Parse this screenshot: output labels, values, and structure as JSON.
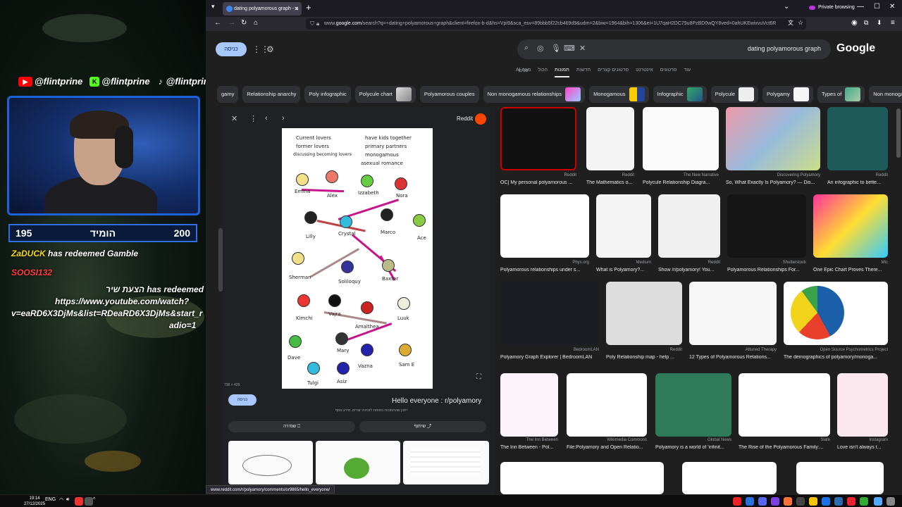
{
  "stream": {
    "socials": [
      "@flintprine",
      "@flintprine",
      "@flintprine"
    ],
    "bet": {
      "left_value": "195",
      "label": "הומיד",
      "right_value": "200"
    },
    "chat": [
      {
        "user": "ZaDUCK",
        "text": "has redeemed Gamble"
      },
      {
        "user": "SOOSI132",
        "text": ""
      },
      {
        "user": "הצעת שיר",
        "text": "has redeemed"
      },
      {
        "text_lines": [
          "https://www.youtube.com/watch?",
          "v=eaRD6X3DjMs&list=RDeaRD6X3DjMs&start_r",
          "adio=1"
        ]
      }
    ]
  },
  "browser": {
    "tab_title": "dating polyamorous graph - ב",
    "private_label": "Private browsing",
    "url_prefix": "www.",
    "url_domain": "google.com",
    "url_rest": "/search?q=+dating+polyamorous+graph&client=firefox-b-d&hs=Vpi9&sca_esv=89bbb5f22cb469d9&udm=2&biw=1964&bih=1306&ei=1U7qaH2DC79u8PzBD0wQY8ved=0ahUKEwixvuVct6R"
  },
  "google": {
    "signin_label": "כניסה",
    "query": "dating polyamorous graph",
    "logo": "Google",
    "tabs": [
      "מצב AI",
      "הכול",
      "תמונות",
      "חדשות",
      "סרטונים קצרים",
      "אינטרנט",
      "סרטונים",
      "עוד"
    ],
    "tools_label": "כלים",
    "chips": [
      "gamy",
      "Relationship anarchy",
      "Poly infographic",
      "Polycule chart",
      "Polyamorous couples",
      "Non monogamous relationships",
      "Monogamous",
      "Infographic",
      "Polycule",
      "Polygamy",
      "Types of",
      "Non monogamy"
    ]
  },
  "preview": {
    "source": "Reddit",
    "size": "738 × 429",
    "visit_label": "כניסה",
    "title": "Hello everyone : r/polyamory",
    "subtitle": "ייתכן שהתמונות כפופות לזכויות יוצרים. מידע נוסף",
    "share_label": "שיתוף",
    "save_label": "שמירה",
    "legend": [
      "Current lovers",
      "have kids together",
      "former lovers",
      "primary partners",
      "discussing becoming lovers",
      "monogamous",
      "asexual romance"
    ],
    "names": [
      "Emma",
      "Alex",
      "Izzabeth",
      "Nora",
      "Lilly",
      "Crystal",
      "Marco",
      "Ace",
      "Sherman",
      "Soliloquy",
      "Baxter",
      "Kimchi",
      "Vajra",
      "Amalthea",
      "Luuk",
      "Dave",
      "Mary",
      "Vazna",
      "Sam E",
      "Tulgi",
      "Asiz"
    ]
  },
  "results": [
    {
      "source": "Reddit",
      "title": "OC] My personal polyamorous ..."
    },
    {
      "source": "Reddit",
      "title": "The Mathematics o..."
    },
    {
      "source": "The New Narrative",
      "title": "Polycule Relationship Diagra..."
    },
    {
      "source": "Discovering Polyamory",
      "title": "So, What Exactly Is Polyamory? — Dis..."
    },
    {
      "source": "Reddit",
      "title": "An infographic to bette..."
    },
    {
      "source": "Phys.org",
      "title": "Polyamorous relationships under s..."
    },
    {
      "source": "Medium",
      "title": "What is Polyamory?..."
    },
    {
      "source": "Reddit",
      "title": "Show /r/polyamory! You..."
    },
    {
      "source": "Shutterstock",
      "title": "Polyamorous Relationships For..."
    },
    {
      "source": "Mic",
      "title": "One Epic Chart Proves There..."
    },
    {
      "source": "BedroomLAN",
      "title": "Polyamory Graph Explorer | BedroomLAN"
    },
    {
      "source": "Reddit",
      "title": "Poly Relationship map - help ..."
    },
    {
      "source": "Attuned Therapy",
      "title": "12 Types of Polyamorous Relations..."
    },
    {
      "source": "Open Source Psychometrics Project",
      "title": "The demographics of polyamory/monoga..."
    },
    {
      "source": "The Inn Between",
      "title": "The Inn Between - Pol..."
    },
    {
      "source": "Wikimedia Commons",
      "title": "File:Polyamory and Open Relatio..."
    },
    {
      "source": "Global News",
      "title": "Polyamory is a world of 'infinit..."
    },
    {
      "source": "Slate",
      "title": "The Rise of the Polyamorous Family:..."
    },
    {
      "source": "Instagram",
      "title": "Love isn't always t..."
    }
  ],
  "status_url": "www.reddit.com/r/polyamory/comments/or9865/hello_everyone/",
  "taskbar": {
    "time": "19:14",
    "date": "27/12/2025",
    "lang": "ENG"
  }
}
